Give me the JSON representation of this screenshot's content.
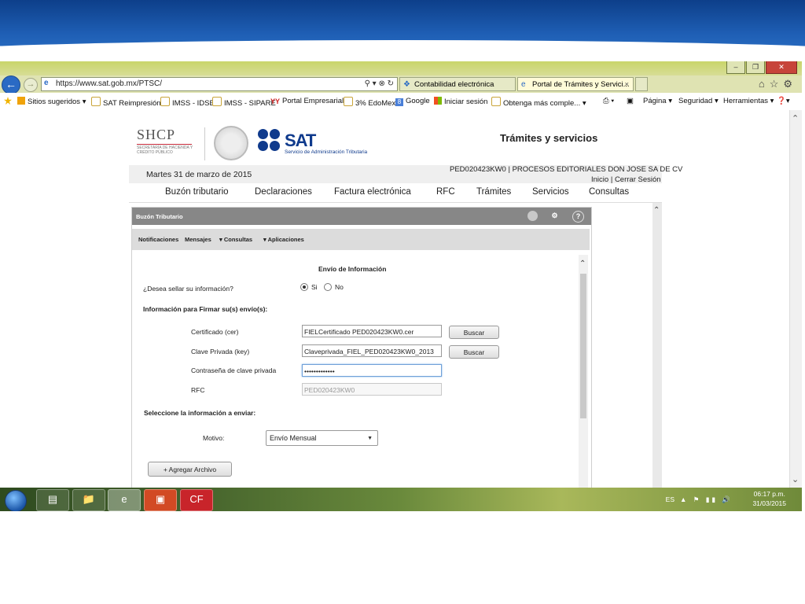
{
  "browser": {
    "url": "https://www.sat.gob.mx/PTSC/",
    "tabs": [
      {
        "label": "Contabilidad electrónica"
      },
      {
        "label": "Portal de Trámites y Servici...",
        "close": "×"
      }
    ]
  },
  "favorites": [
    {
      "label": "Sitios sugeridos ▾",
      "icon": "bing-icon"
    },
    {
      "label": "SAT Reimpresión",
      "icon": "ie-page-icon"
    },
    {
      "label": "IMSS - IDSE",
      "icon": "ie-page-icon"
    },
    {
      "label": "IMSS - SIPARE",
      "icon": "ie-page-icon"
    },
    {
      "label": "Portal Empresarial",
      "icon": "yy-icon"
    },
    {
      "label": "3% EdoMex",
      "icon": "ie-page-icon"
    },
    {
      "label": "Google",
      "icon": "google-icon"
    },
    {
      "label": "Iniciar sesión",
      "icon": "microsoft-icon"
    },
    {
      "label": "Obtenga más comple... ▾",
      "icon": "ie-page-icon"
    }
  ],
  "command_bar": [
    "Página ▾",
    "Seguridad ▾",
    "Herramientas ▾"
  ],
  "site": {
    "shcp_title": "SHCP",
    "shcp_sub": "SECRETARÍA DE HACIENDA Y CRÉDITO PÚBLICO",
    "sat_title": "SAT",
    "sat_sub": "Servicio de Administración Tributaria",
    "section_title": "Trámites y servicios",
    "date": "Martes 31 de marzo de 2015",
    "rfc_company": "PED020423KW0 | PROCESOS EDITORIALES DON JOSE SA DE CV",
    "inicio": "Inicio",
    "sep": "|",
    "cerrar": "Cerrar Sesión",
    "nav": [
      "Buzón tributario",
      "Declaraciones",
      "Factura electrónica",
      "RFC",
      "Trámites",
      "Servicios",
      "Consultas"
    ]
  },
  "panel": {
    "title": "Buzón Tributario",
    "sub_items": [
      "Notificaciones",
      "Mensajes",
      "▾ Consultas",
      "▾ Aplicaciones"
    ],
    "form_title": "Envío de Información",
    "q_sellar": "¿Desea sellar su información?",
    "opt_si": "Si",
    "opt_no": "No",
    "info_firmar": "Información para Firmar su(s) envío(s):",
    "lbl_cert": "Certificado (cer)",
    "val_cert": "FIELCertificado PED020423KW0.cer",
    "lbl_key": "Clave Privada (key)",
    "val_key": "Claveprivada_FIEL_PED020423KW0_2013",
    "lbl_pass": "Contraseña de clave privada",
    "val_pass": "•••••••••••••",
    "lbl_rfc": "RFC",
    "val_rfc": "PED020423KW0",
    "btn_buscar": "Buscar",
    "seleccione": "Seleccione la información a enviar:",
    "lbl_motivo": "Motivo:",
    "val_motivo": "Envío Mensual",
    "btn_agregar": "+ Agregar Archivo"
  },
  "taskbar": {
    "lang": "ES",
    "time": "06:17 p.m.",
    "date": "31/03/2015"
  }
}
